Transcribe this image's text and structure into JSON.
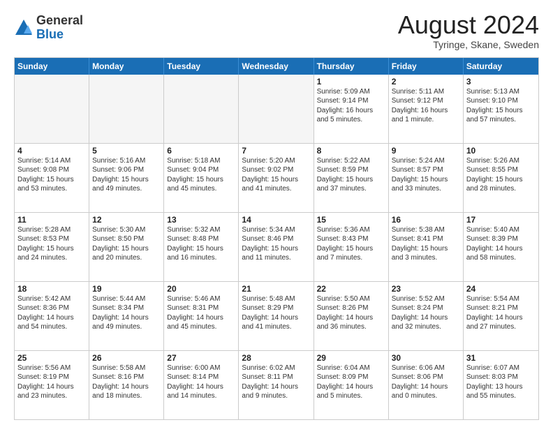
{
  "header": {
    "logo_general": "General",
    "logo_blue": "Blue",
    "month_title": "August 2024",
    "location": "Tyringe, Skane, Sweden"
  },
  "weekdays": [
    "Sunday",
    "Monday",
    "Tuesday",
    "Wednesday",
    "Thursday",
    "Friday",
    "Saturday"
  ],
  "rows": [
    [
      {
        "day": "",
        "info": "",
        "empty": true
      },
      {
        "day": "",
        "info": "",
        "empty": true
      },
      {
        "day": "",
        "info": "",
        "empty": true
      },
      {
        "day": "",
        "info": "",
        "empty": true
      },
      {
        "day": "1",
        "info": "Sunrise: 5:09 AM\nSunset: 9:14 PM\nDaylight: 16 hours\nand 5 minutes."
      },
      {
        "day": "2",
        "info": "Sunrise: 5:11 AM\nSunset: 9:12 PM\nDaylight: 16 hours\nand 1 minute."
      },
      {
        "day": "3",
        "info": "Sunrise: 5:13 AM\nSunset: 9:10 PM\nDaylight: 15 hours\nand 57 minutes."
      }
    ],
    [
      {
        "day": "4",
        "info": "Sunrise: 5:14 AM\nSunset: 9:08 PM\nDaylight: 15 hours\nand 53 minutes."
      },
      {
        "day": "5",
        "info": "Sunrise: 5:16 AM\nSunset: 9:06 PM\nDaylight: 15 hours\nand 49 minutes."
      },
      {
        "day": "6",
        "info": "Sunrise: 5:18 AM\nSunset: 9:04 PM\nDaylight: 15 hours\nand 45 minutes."
      },
      {
        "day": "7",
        "info": "Sunrise: 5:20 AM\nSunset: 9:02 PM\nDaylight: 15 hours\nand 41 minutes."
      },
      {
        "day": "8",
        "info": "Sunrise: 5:22 AM\nSunset: 8:59 PM\nDaylight: 15 hours\nand 37 minutes."
      },
      {
        "day": "9",
        "info": "Sunrise: 5:24 AM\nSunset: 8:57 PM\nDaylight: 15 hours\nand 33 minutes."
      },
      {
        "day": "10",
        "info": "Sunrise: 5:26 AM\nSunset: 8:55 PM\nDaylight: 15 hours\nand 28 minutes."
      }
    ],
    [
      {
        "day": "11",
        "info": "Sunrise: 5:28 AM\nSunset: 8:53 PM\nDaylight: 15 hours\nand 24 minutes."
      },
      {
        "day": "12",
        "info": "Sunrise: 5:30 AM\nSunset: 8:50 PM\nDaylight: 15 hours\nand 20 minutes."
      },
      {
        "day": "13",
        "info": "Sunrise: 5:32 AM\nSunset: 8:48 PM\nDaylight: 15 hours\nand 16 minutes."
      },
      {
        "day": "14",
        "info": "Sunrise: 5:34 AM\nSunset: 8:46 PM\nDaylight: 15 hours\nand 11 minutes."
      },
      {
        "day": "15",
        "info": "Sunrise: 5:36 AM\nSunset: 8:43 PM\nDaylight: 15 hours\nand 7 minutes."
      },
      {
        "day": "16",
        "info": "Sunrise: 5:38 AM\nSunset: 8:41 PM\nDaylight: 15 hours\nand 3 minutes."
      },
      {
        "day": "17",
        "info": "Sunrise: 5:40 AM\nSunset: 8:39 PM\nDaylight: 14 hours\nand 58 minutes."
      }
    ],
    [
      {
        "day": "18",
        "info": "Sunrise: 5:42 AM\nSunset: 8:36 PM\nDaylight: 14 hours\nand 54 minutes."
      },
      {
        "day": "19",
        "info": "Sunrise: 5:44 AM\nSunset: 8:34 PM\nDaylight: 14 hours\nand 49 minutes."
      },
      {
        "day": "20",
        "info": "Sunrise: 5:46 AM\nSunset: 8:31 PM\nDaylight: 14 hours\nand 45 minutes."
      },
      {
        "day": "21",
        "info": "Sunrise: 5:48 AM\nSunset: 8:29 PM\nDaylight: 14 hours\nand 41 minutes."
      },
      {
        "day": "22",
        "info": "Sunrise: 5:50 AM\nSunset: 8:26 PM\nDaylight: 14 hours\nand 36 minutes."
      },
      {
        "day": "23",
        "info": "Sunrise: 5:52 AM\nSunset: 8:24 PM\nDaylight: 14 hours\nand 32 minutes."
      },
      {
        "day": "24",
        "info": "Sunrise: 5:54 AM\nSunset: 8:21 PM\nDaylight: 14 hours\nand 27 minutes."
      }
    ],
    [
      {
        "day": "25",
        "info": "Sunrise: 5:56 AM\nSunset: 8:19 PM\nDaylight: 14 hours\nand 23 minutes."
      },
      {
        "day": "26",
        "info": "Sunrise: 5:58 AM\nSunset: 8:16 PM\nDaylight: 14 hours\nand 18 minutes."
      },
      {
        "day": "27",
        "info": "Sunrise: 6:00 AM\nSunset: 8:14 PM\nDaylight: 14 hours\nand 14 minutes."
      },
      {
        "day": "28",
        "info": "Sunrise: 6:02 AM\nSunset: 8:11 PM\nDaylight: 14 hours\nand 9 minutes."
      },
      {
        "day": "29",
        "info": "Sunrise: 6:04 AM\nSunset: 8:09 PM\nDaylight: 14 hours\nand 5 minutes."
      },
      {
        "day": "30",
        "info": "Sunrise: 6:06 AM\nSunset: 8:06 PM\nDaylight: 14 hours\nand 0 minutes."
      },
      {
        "day": "31",
        "info": "Sunrise: 6:07 AM\nSunset: 8:03 PM\nDaylight: 13 hours\nand 55 minutes."
      }
    ]
  ]
}
